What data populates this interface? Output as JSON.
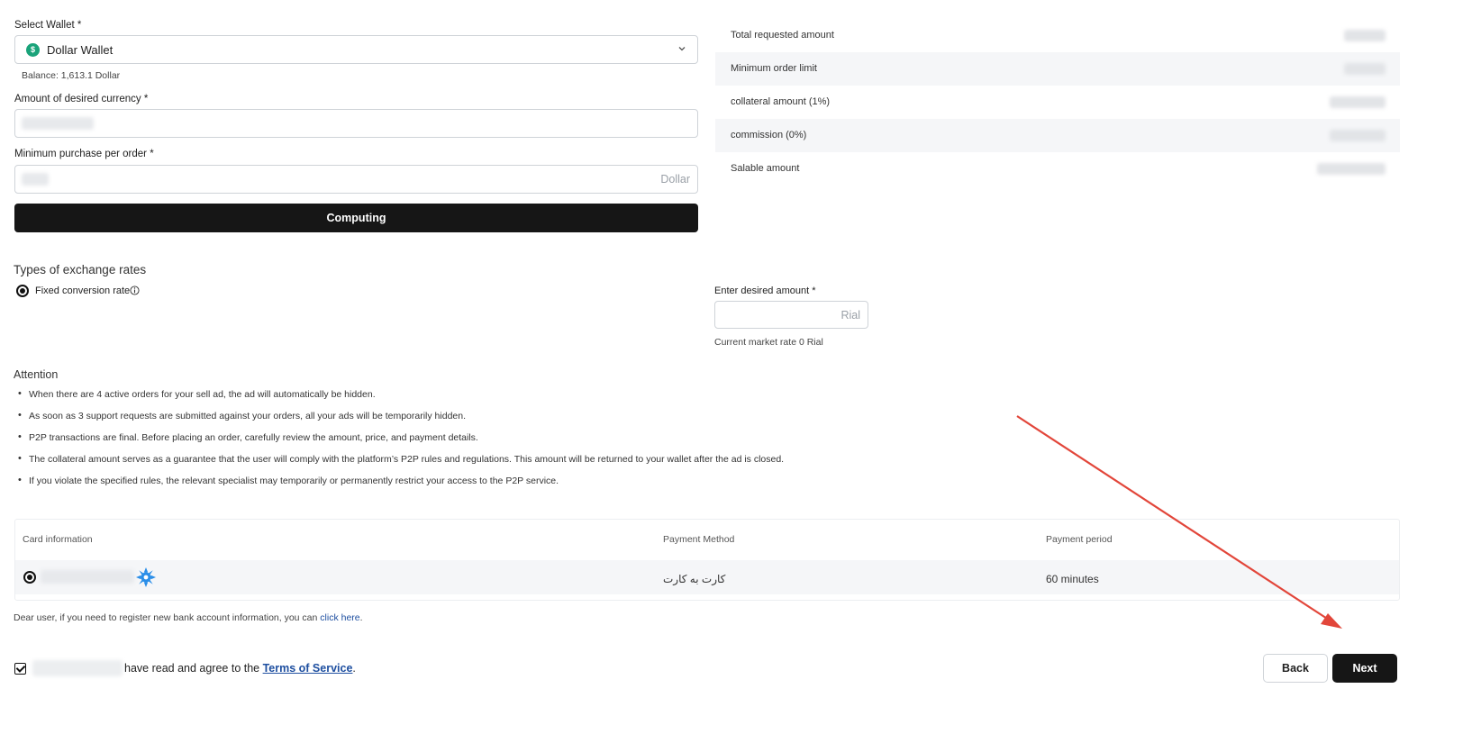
{
  "form": {
    "wallet_label": "Select Wallet *",
    "wallet_value": "Dollar Wallet",
    "wallet_icon": "dollar-circle-icon",
    "balance_text": "Balance: 1,613.1 Dollar",
    "amount_label": "Amount of desired currency *",
    "min_purchase_label": "Minimum purchase per order *",
    "min_purchase_suffix": "Dollar",
    "compute_button": "Computing"
  },
  "summary": {
    "rows": [
      {
        "label": "Total requested amount"
      },
      {
        "label": "Minimum order limit"
      },
      {
        "label": "collateral amount (1%)"
      },
      {
        "label": "commission (0%)"
      },
      {
        "label": "Salable amount"
      }
    ]
  },
  "rates": {
    "heading": "Types of exchange rates",
    "fixed_label": "Fixed conversion rate",
    "info_icon": "info-icon",
    "amount_label": "Enter desired amount *",
    "amount_suffix": "Rial",
    "market_rate": "Current market rate 0 Rial"
  },
  "attention": {
    "heading": "Attention",
    "items": [
      "When there are 4 active orders for your sell ad, the ad will automatically be hidden.",
      "As soon as 3 support requests are submitted against your orders, all your ads will be temporarily hidden.",
      "P2P transactions are final. Before placing an order, carefully review the amount, price, and payment details.",
      "The collateral amount serves as a guarantee that the user will comply with the platform’s P2P rules and regulations. This amount will be returned to your wallet after the ad is closed.",
      "If you violate the specified rules, the relevant specialist may temporarily or permanently restrict your access to the P2P service."
    ]
  },
  "table": {
    "columns": [
      "Card information",
      "Payment Method",
      "Payment period"
    ],
    "rows": [
      {
        "payment_method": "کارت به کارت",
        "payment_period": "60 minutes",
        "bank_icon": "bank-logo-icon"
      }
    ]
  },
  "register": {
    "text": "Dear user, if you need to register new bank account information, you can ",
    "link": "click here",
    "end": "."
  },
  "terms": {
    "text": "have read and agree to the ",
    "link": "Terms of Service",
    "end": "."
  },
  "footer": {
    "back": "Back",
    "next": "Next"
  },
  "colors": {
    "primary": "#161616",
    "wallet_icon": "#1aa37a",
    "link": "#1e4fa0",
    "annotation_arrow": "#e2463a"
  }
}
